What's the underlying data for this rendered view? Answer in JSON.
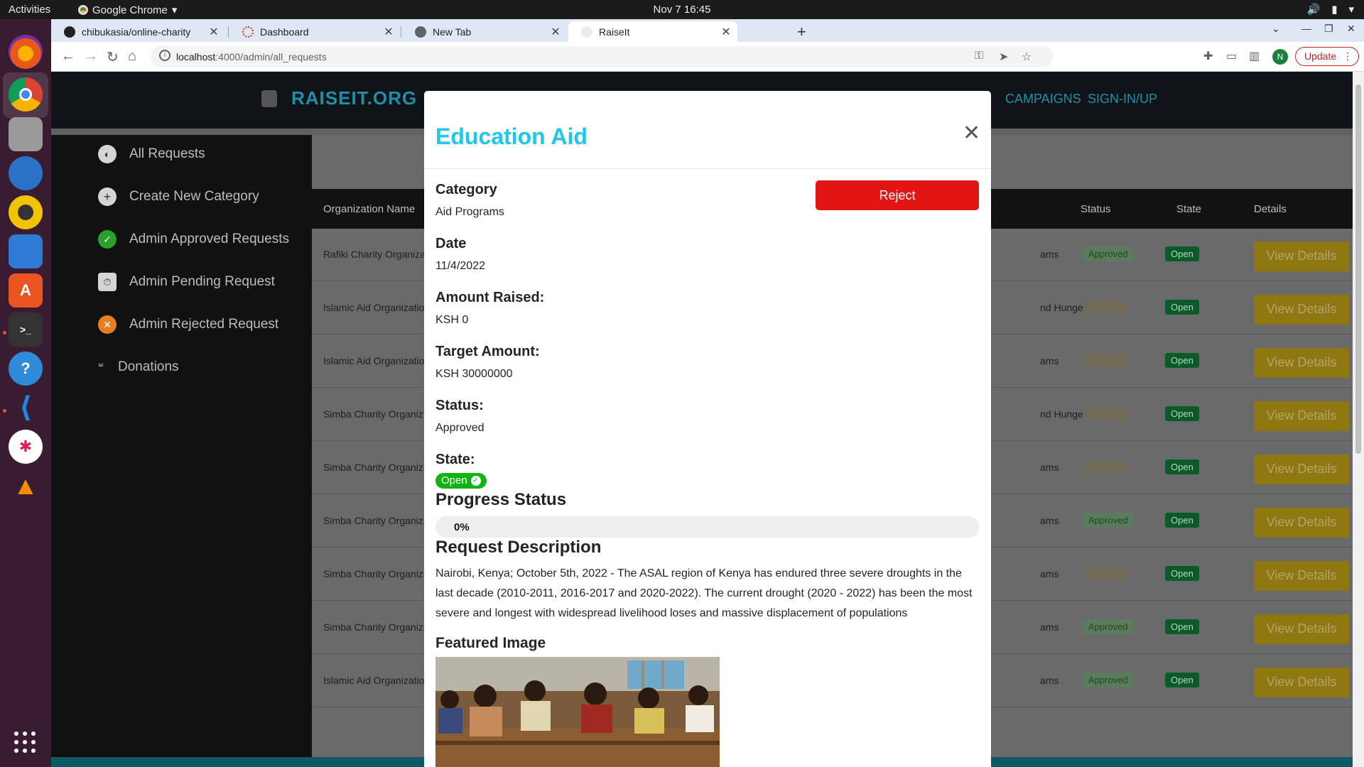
{
  "os": {
    "activities": "Activities",
    "app_menu": "Google Chrome",
    "clock": "Nov 7  16:45"
  },
  "browser": {
    "tabs": [
      {
        "title": "chibukasia/online-charity",
        "active": false
      },
      {
        "title": "Dashboard",
        "active": false
      },
      {
        "title": "New Tab",
        "active": false
      },
      {
        "title": "RaiseIt",
        "active": true
      }
    ],
    "url_host": "localhost",
    "url_path": ":4000/admin/all_requests",
    "profile_initial": "N",
    "update_label": "Update"
  },
  "site": {
    "logo": "RAISEIT.ORG",
    "nav": [
      "CAMPAIGNS",
      "SIGN-IN/UP"
    ],
    "sidebar": [
      {
        "label": "All Requests",
        "icon": "globe-icon"
      },
      {
        "label": "Create New Category",
        "icon": "plus-circle-icon"
      },
      {
        "label": "Admin Approved Requests",
        "icon": "check-badge-icon"
      },
      {
        "label": "Admin Pending Request",
        "icon": "clipboard-clock-icon"
      },
      {
        "label": "Admin Rejected Request",
        "icon": "x-circle-icon"
      },
      {
        "label": "Donations",
        "icon": "hands-icon"
      }
    ],
    "table": {
      "headers": {
        "org": "Organization Name",
        "status": "Status",
        "state": "State",
        "details": "Details"
      },
      "rows": [
        {
          "org": "Rafiki Charity Organiza",
          "cat": "ams",
          "status": "Approved",
          "state": "Open",
          "action": "View Details"
        },
        {
          "org": "Islamic Aid Organizatio",
          "cat": "nd Hunger",
          "status": "Pending",
          "state": "Open",
          "action": "View Details"
        },
        {
          "org": "Islamic Aid Organizatio",
          "cat": "ams",
          "status": "Pending",
          "state": "Open",
          "action": "View Details"
        },
        {
          "org": "Simba Charity Organiz",
          "cat": "nd Hunger",
          "status": "Pending",
          "state": "Open",
          "action": "View Details"
        },
        {
          "org": "Simba Charity Organiz",
          "cat": "ams",
          "status": "Pending",
          "state": "Open",
          "action": "View Details"
        },
        {
          "org": "Simba Charity Organiz",
          "cat": "ams",
          "status": "Approved",
          "state": "Open",
          "action": "View Details"
        },
        {
          "org": "Simba Charity Organiz",
          "cat": "ams",
          "status": "Pending",
          "state": "Open",
          "action": "View Details"
        },
        {
          "org": "Simba Charity Organiz",
          "cat": "ams",
          "status": "Approved",
          "state": "Open",
          "action": "View Details"
        },
        {
          "org": "Islamic Aid Organizatio",
          "cat": "ams",
          "status": "Approved",
          "state": "Open",
          "action": "View Details"
        }
      ]
    }
  },
  "modal": {
    "title": "Education Aid",
    "reject_label": "Reject",
    "category_label": "Category",
    "category": "Aid Programs",
    "date_label": "Date",
    "date": "11/4/2022",
    "amount_raised_label": "Amount Raised:",
    "amount_raised": "KSH 0",
    "target_label": "Target Amount:",
    "target": "KSH 30000000",
    "status_label": "Status:",
    "status": "Approved",
    "state_label": "State:",
    "state": "Open",
    "progress_label": "Progress Status",
    "progress_text": "0%",
    "progress_value": 0,
    "description_label": "Request Description",
    "description": "Nairobi, Kenya; October 5th, 2022 - The ASAL region of Kenya has endured three severe droughts in the last decade (2010-2011, 2016-2017 and 2020-2022). The current drought (2020 - 2022) has been the most severe and longest with widespread livelihood loses and massive displacement of populations",
    "featured_label": "Featured Image"
  },
  "colors": {
    "accent": "#1fc8e8",
    "reject": "#e31414",
    "open_badge": "#11b311"
  }
}
